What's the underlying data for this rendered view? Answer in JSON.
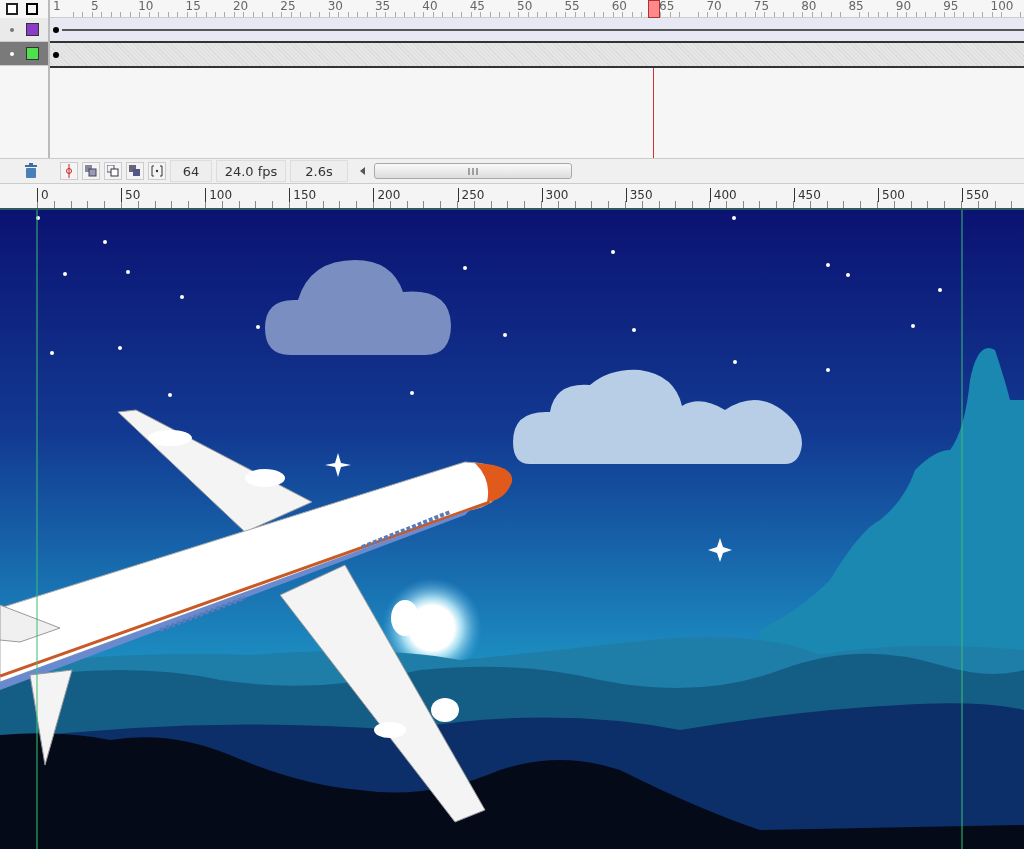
{
  "timeline": {
    "frame_ruler": [
      "1",
      "5",
      "10",
      "15",
      "20",
      "25",
      "30",
      "35",
      "40",
      "45",
      "50",
      "55",
      "60",
      "65",
      "70",
      "75",
      "80",
      "85",
      "90",
      "95",
      "100"
    ],
    "playhead": {
      "level": 0.62
    },
    "layers": [
      {
        "kind": "tween",
        "selected": false,
        "color": "#8a3cc8"
      },
      {
        "kind": "keyframe",
        "selected": true,
        "color": "#4ee04e"
      }
    ]
  },
  "toolbar": {
    "current_frame": "64",
    "frame_rate": "24.0 fps",
    "elapsed_time": "2.6s"
  },
  "stage": {
    "ruler": [
      "0",
      "50",
      "100",
      "150",
      "200",
      "250",
      "300",
      "350",
      "400",
      "450",
      "500",
      "550"
    ]
  }
}
